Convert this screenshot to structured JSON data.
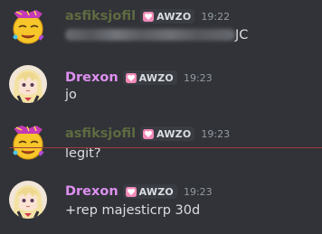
{
  "messages": [
    {
      "username": "asfiksjofil",
      "tag": "AWZO",
      "time": "19:22",
      "content_visible": "JC"
    },
    {
      "username": "Drexon",
      "tag": "AWZO",
      "time": "19:23",
      "content": "jo"
    },
    {
      "username": "asfiksjofil",
      "tag": "AWZO",
      "time": "19:23",
      "content": "legit?"
    },
    {
      "username": "Drexon",
      "tag": "AWZO",
      "time": "19:23",
      "content": "+rep majesticrp 30d"
    }
  ],
  "colors": {
    "background": "#313338",
    "username_faded": "#5f6a40",
    "username_drexon": "#dd8ff0",
    "message_text": "#dbdee1",
    "timestamp": "#949ba4",
    "tag_background": "#3a3c43",
    "tag_heart": "#f28ab8",
    "new_messages_divider": "#a13c3c"
  },
  "icons": {
    "avatar_1": "smiley-emoji-avatar",
    "avatar_2": "anime-girl-avatar",
    "tag_icon": "heart-icon"
  }
}
